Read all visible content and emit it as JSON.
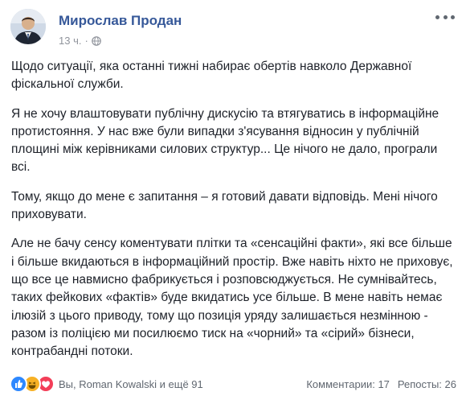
{
  "post": {
    "author": "Мирослав Продан",
    "time": "13 ч.",
    "paragraphs": [
      "Щодо ситуації, яка останні тижні набирає обертів навколо Державної фіскальної служби.",
      "Я не хочу влаштовувати публічну дискусію та втягуватись в інформаційне протистояння. У нас вже були випадки з'ясування відносин у публічній площині між керівниками силових структур... Це нічого не дало, програли всі.",
      "Тому, якщо до мене є запитання – я готовий давати відповідь. Мені нічого приховувати.",
      "Але не бачу сенсу коментувати плітки та «сенсаційні факти», які все більше і більше вкидаються в інформаційний простір. Вже навіть ніхто не приховує, що все це навмисно фабрикується і розповсюджується. Не сумнівайтесь, таких фейкових «фактів» буде вкидатись усе більше. В мене навіть немає ілюзій з цього приводу, тому що позиція уряду залишається незмінною - разом із поліцією ми посилюємо тиск на «чорний» та «сірий» бізнеси, контрабандні потоки."
    ]
  },
  "footer": {
    "reaction_text": "Вы, Roman Kowalski и ещё 91",
    "comments": "Комментарии: 17",
    "shares": "Репосты: 26"
  },
  "icons": {
    "visibility": "globe-icon",
    "menu": "more-options-icon",
    "reactions": [
      "like-reaction-icon",
      "haha-reaction-icon",
      "love-reaction-icon"
    ]
  },
  "colors": {
    "author": "#365899",
    "meta": "#90949c",
    "text": "#1d2129",
    "like": "#2d88ff",
    "haha": "#f7b125",
    "love": "#f33e58"
  }
}
